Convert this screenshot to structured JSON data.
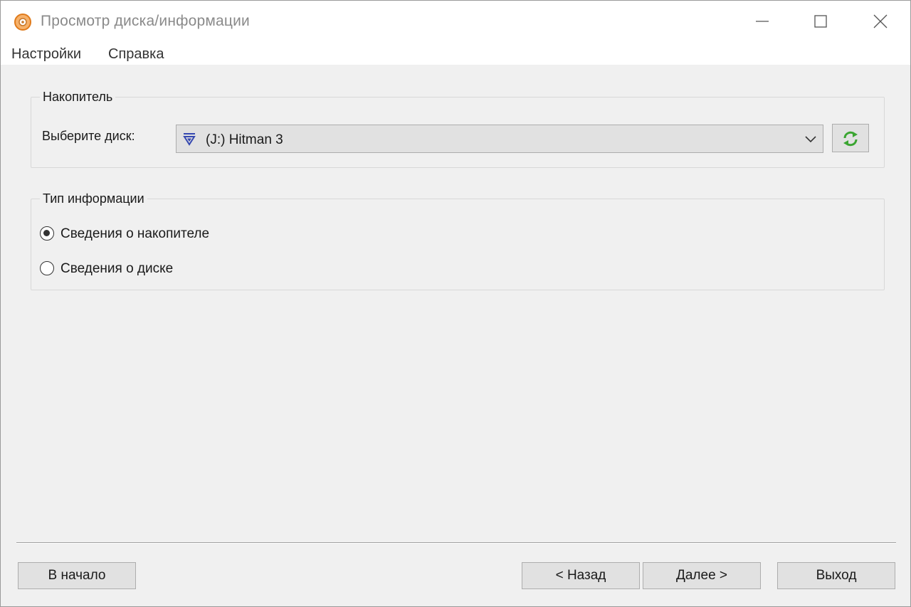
{
  "window": {
    "title": "Просмотр диска/информации",
    "app_icon": "disc-icon",
    "controls": [
      "minimize-icon",
      "maximize-icon",
      "close-icon"
    ]
  },
  "menubar": {
    "items": [
      {
        "label": "Настройки"
      },
      {
        "label": "Справка"
      }
    ]
  },
  "drive_group": {
    "legend": "Накопитель",
    "select_label": "Выберите диск:",
    "selected_drive": "(J:) Hitman 3",
    "drive_icon": "optical-drive-icon",
    "refresh_icon": "refresh-icon"
  },
  "info_group": {
    "legend": "Тип информации",
    "options": [
      {
        "label": "Сведения о накопителе",
        "selected": true
      },
      {
        "label": "Сведения о диске",
        "selected": false
      }
    ]
  },
  "footer": {
    "start_label": "В начало",
    "back_label": "< Назад",
    "next_label": "Далее >",
    "exit_label": "Выход"
  },
  "colors": {
    "window_bg": "#f0f0f0",
    "button_bg": "#e1e1e1",
    "button_border": "#adadad",
    "refresh_green": "#3aa531",
    "drive_icon_blue": "#3548b0"
  }
}
